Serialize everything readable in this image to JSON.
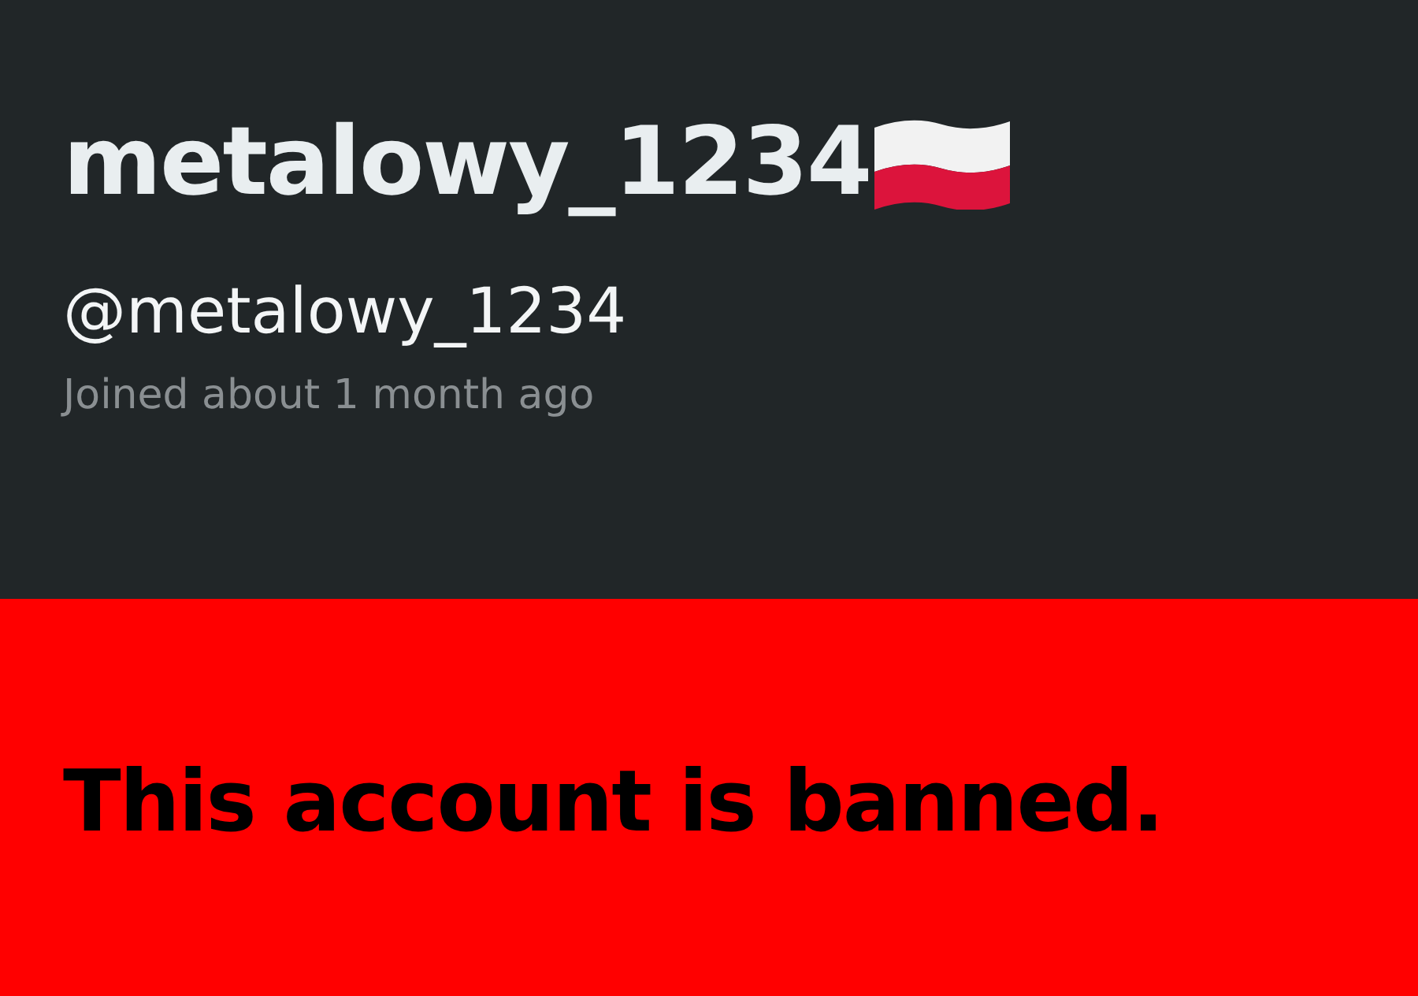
{
  "profile": {
    "display_name": "metalowy_1234",
    "handle": "@metalowy_1234",
    "joined": "Joined about 1 month ago"
  },
  "banner": {
    "message": "This account is banned."
  }
}
